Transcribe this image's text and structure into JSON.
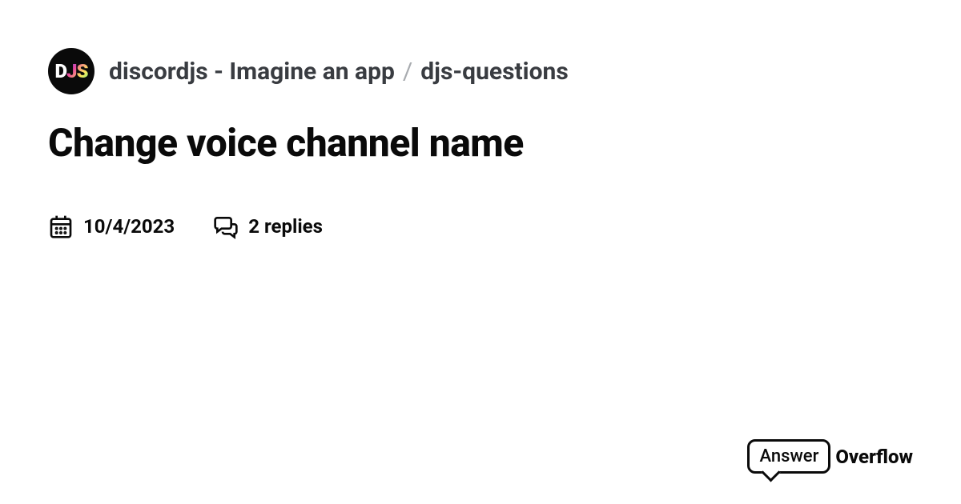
{
  "header": {
    "avatar_text_parts": [
      "D",
      "J",
      "S"
    ],
    "server_name": "discordjs - Imagine an app",
    "separator": "/",
    "channel_name": "djs-questions"
  },
  "title": "Change voice channel name",
  "meta": {
    "date": "10/4/2023",
    "replies": "2 replies"
  },
  "brand": {
    "word1": "Answer",
    "word2": "Overflow"
  }
}
